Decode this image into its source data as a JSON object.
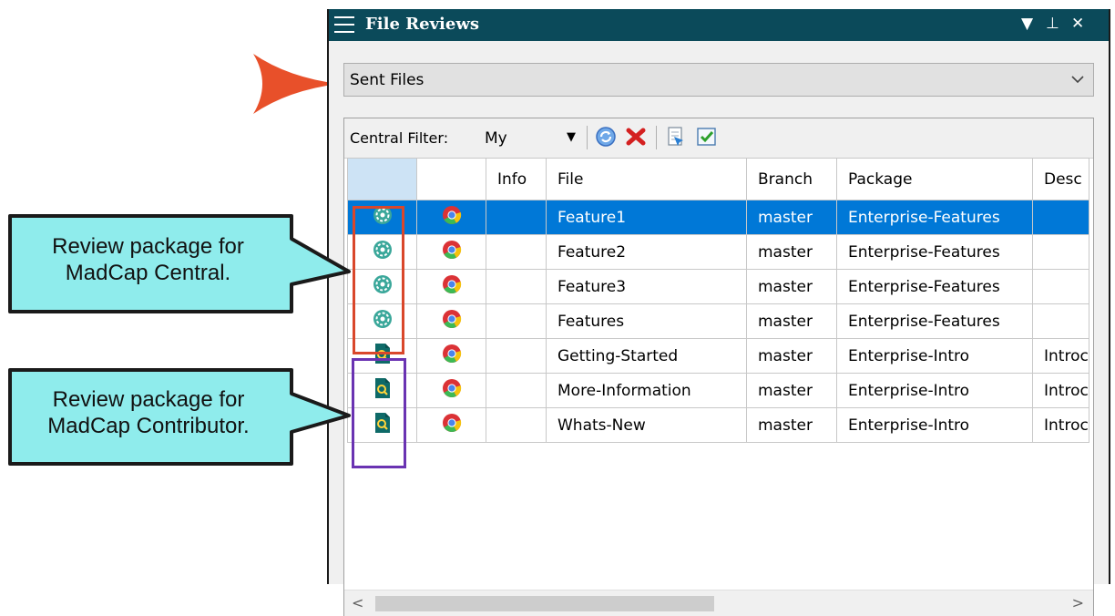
{
  "window": {
    "title": "File Reviews"
  },
  "view_selector": {
    "selected": "Sent Files"
  },
  "toolbar": {
    "central_filter_label": "Central Filter:",
    "central_filter_value": "My"
  },
  "grid": {
    "columns": [
      "",
      "",
      "Info",
      "File",
      "Branch",
      "Package",
      "Desc"
    ],
    "rows": [
      {
        "type_icon": "central-package-icon",
        "app_icon": "chrome-icon",
        "info": "",
        "file": "Feature1",
        "branch": "master",
        "package": "Enterprise-Features",
        "desc": ""
      },
      {
        "type_icon": "central-package-icon",
        "app_icon": "chrome-icon",
        "info": "",
        "file": "Feature2",
        "branch": "master",
        "package": "Enterprise-Features",
        "desc": ""
      },
      {
        "type_icon": "central-package-icon",
        "app_icon": "chrome-icon",
        "info": "",
        "file": "Feature3",
        "branch": "master",
        "package": "Enterprise-Features",
        "desc": ""
      },
      {
        "type_icon": "central-package-icon",
        "app_icon": "chrome-icon",
        "info": "",
        "file": "Features",
        "branch": "master",
        "package": "Enterprise-Features",
        "desc": ""
      },
      {
        "type_icon": "contributor-package-icon",
        "app_icon": "chrome-icon",
        "info": "",
        "file": "Getting-Started",
        "branch": "master",
        "package": "Enterprise-Intro",
        "desc": "Introc"
      },
      {
        "type_icon": "contributor-package-icon",
        "app_icon": "chrome-icon",
        "info": "",
        "file": "More-Information",
        "branch": "master",
        "package": "Enterprise-Intro",
        "desc": "Introc"
      },
      {
        "type_icon": "contributor-package-icon",
        "app_icon": "chrome-icon",
        "info": "",
        "file": "Whats-New",
        "branch": "master",
        "package": "Enterprise-Intro",
        "desc": "Introc"
      }
    ]
  },
  "callouts": [
    {
      "text": "Review package for MadCap Central."
    },
    {
      "text": "Review package for MadCap Contributor."
    }
  ],
  "colors": {
    "titlebar": "#0b4a5a",
    "selection": "#0078d7",
    "arrow": "#e8502a",
    "callout_fill": "#8fecec",
    "central_highlight": "#d9472b",
    "contributor_highlight": "#6a33b2"
  }
}
